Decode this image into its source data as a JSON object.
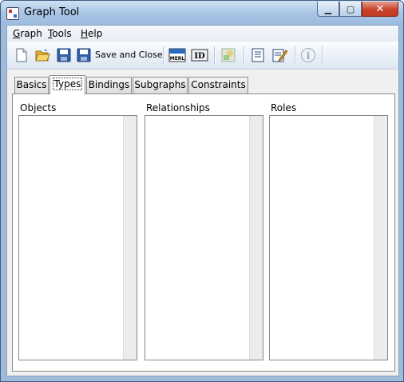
{
  "window": {
    "title": "Graph Tool"
  },
  "menu": [
    {
      "label": "Graph",
      "mnemonic": "G",
      "rest": "raph"
    },
    {
      "label": "Tools",
      "mnemonic": "T",
      "rest": "ools"
    },
    {
      "label": "Help",
      "mnemonic": "H",
      "rest": "elp"
    }
  ],
  "toolbar": {
    "save_close_label": "Save and Close",
    "merl_label": "MERL",
    "id_label": "ID",
    "info_label": "i"
  },
  "tabs": [
    "Basics",
    "Types",
    "Bindings",
    "Subgraphs",
    "Constraints"
  ],
  "active_tab": "Types",
  "columns": {
    "objects": "Objects",
    "relationships": "Relationships",
    "roles": "Roles"
  }
}
